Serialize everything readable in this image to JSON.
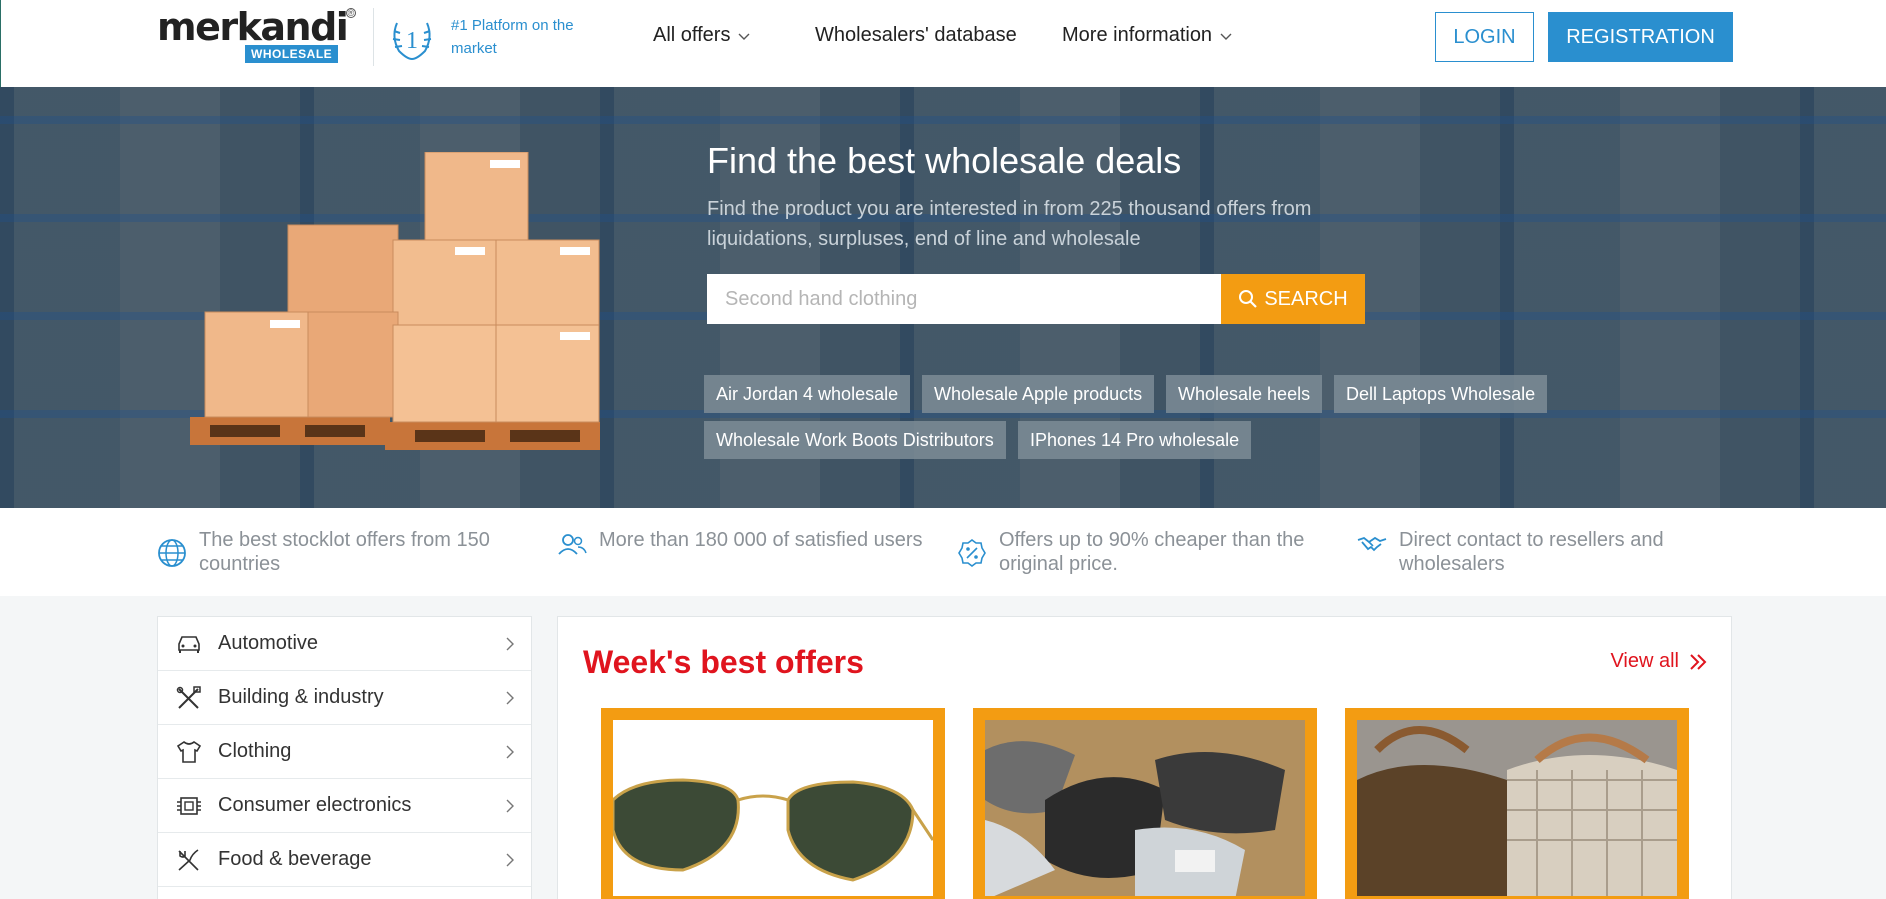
{
  "header": {
    "logo_word": "merkandi",
    "logo_badge": "WHOLESALE",
    "logo_reg": "®",
    "award_text": "#1 Platform on the market",
    "nav": [
      {
        "label": "All offers",
        "icon": "chevron-down-icon"
      },
      {
        "label": "Wholesalers' database"
      },
      {
        "label": "More information",
        "icon": "chevron-down-icon"
      }
    ],
    "login_label": "LOGIN",
    "register_label": "REGISTRATION"
  },
  "hero": {
    "title": "Find the best wholesale deals",
    "subtitle": "Find the product you are interested in from 225 thousand offers from liquidations, surpluses, end of line and wholesale",
    "search_placeholder": "Second hand clothing",
    "search_button": "SEARCH",
    "chips": [
      "Air Jordan 4 wholesale",
      "Wholesale Apple products",
      "Wholesale heels",
      "Dell Laptops Wholesale",
      "Wholesale Work Boots Distributors",
      "IPhones 14 Pro wholesale"
    ]
  },
  "features": [
    {
      "icon": "globe-icon",
      "text": "The best stocklot offers from 150 countries"
    },
    {
      "icon": "users-icon",
      "text": "More than 180 000 of satisfied users"
    },
    {
      "icon": "discount-badge-icon",
      "text": "Offers up to 90% cheaper than the original price."
    },
    {
      "icon": "handshake-icon",
      "text": "Direct contact to resellers and wholesalers"
    }
  ],
  "categories": [
    {
      "label": "Automotive",
      "icon": "car-icon"
    },
    {
      "label": "Building & industry",
      "icon": "tools-icon"
    },
    {
      "label": "Clothing",
      "icon": "shirt-icon"
    },
    {
      "label": "Consumer electronics",
      "icon": "chip-icon"
    },
    {
      "label": "Food & beverage",
      "icon": "cutlery-icon"
    }
  ],
  "offers": {
    "title": "Week's best offers",
    "view_all": "View all",
    "cards": [
      {
        "image": "sunglasses-image"
      },
      {
        "image": "clothing-parcels-image"
      },
      {
        "image": "handbags-image"
      }
    ]
  },
  "colors": {
    "brand_blue": "#2a8fcf",
    "accent_orange": "#f39c12",
    "offer_red": "#e0141e"
  }
}
